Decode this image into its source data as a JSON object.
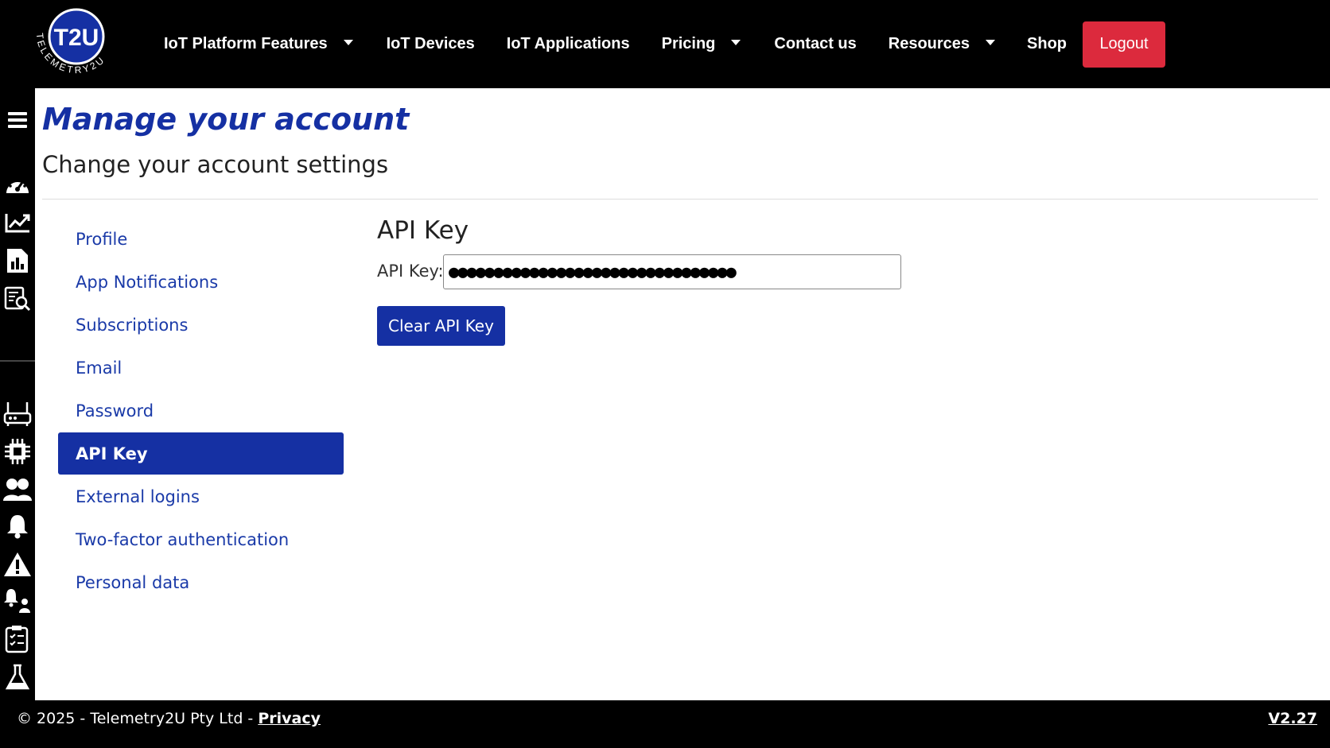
{
  "brand": {
    "logo_text": "T2U",
    "logo_ring_text": "TELEMETRY2U"
  },
  "nav": {
    "items": [
      {
        "label": "IoT Platform Features",
        "dropdown": true
      },
      {
        "label": "IoT Devices",
        "dropdown": false
      },
      {
        "label": "IoT Applications",
        "dropdown": false
      },
      {
        "label": "Pricing",
        "dropdown": true
      },
      {
        "label": "Contact us",
        "dropdown": false
      },
      {
        "label": "Resources",
        "dropdown": true
      },
      {
        "label": "Shop",
        "dropdown": false
      }
    ],
    "logout_label": "Logout"
  },
  "sidebar": {
    "icons": [
      "menu-icon",
      "dashboard-gauge-icon",
      "trend-chart-icon",
      "report-icon",
      "data-search-icon",
      "gateway-router-icon",
      "chip-icon",
      "users-icon",
      "bell-icon",
      "warning-icon",
      "alert-rules-icon",
      "checklist-icon",
      "lab-flask-icon"
    ]
  },
  "header": {
    "title": "Manage your account",
    "subtitle": "Change your account settings"
  },
  "settings_menu": {
    "items": [
      {
        "label": "Profile",
        "active": false
      },
      {
        "label": "App Notifications",
        "active": false
      },
      {
        "label": "Subscriptions",
        "active": false
      },
      {
        "label": "Email",
        "active": false
      },
      {
        "label": "Password",
        "active": false
      },
      {
        "label": "API Key",
        "active": true
      },
      {
        "label": "External logins",
        "active": false
      },
      {
        "label": "Two-factor authentication",
        "active": false
      },
      {
        "label": "Personal data",
        "active": false
      }
    ]
  },
  "api_key": {
    "section_title": "API Key",
    "field_label": "API Key:",
    "masked_value": "●●●●●●●●●●●●●●●●●●●●●●●●●●●●●●●●",
    "clear_button": "Clear API Key"
  },
  "footer": {
    "copyright": "© 2025 - Telemetry2U Pty Ltd - ",
    "privacy_link": "Privacy",
    "version": "V2.27"
  },
  "colors": {
    "brand_blue": "#1530a3",
    "logout_red": "#dc2a3d",
    "nav_bg": "#000000"
  }
}
